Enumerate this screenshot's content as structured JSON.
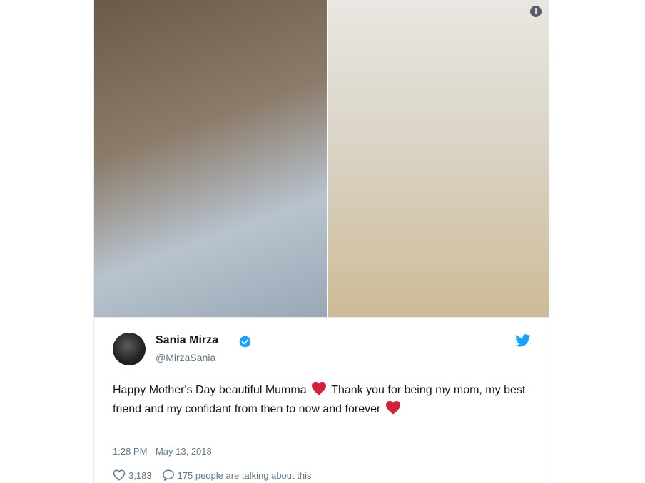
{
  "tweet": {
    "display_name": "Sania Mirza",
    "handle": "@MirzaSania",
    "text_part1": "Happy Mother's Day beautiful Mumma",
    "text_part2": "Thank you for being my mom, my best friend and my confidant from then to now and forever",
    "timestamp": "1:28 PM - May 13, 2018",
    "like_count": "3,183",
    "conversation_text": "175 people are talking about this"
  },
  "icons": {
    "info": "info-icon",
    "verified": "verified-badge-icon",
    "twitter": "twitter-bird-icon",
    "heart_emoji": "red-heart-emoji",
    "like": "heart-outline-icon",
    "reply": "speech-bubble-icon"
  },
  "colors": {
    "twitter_blue": "#1da1f2",
    "heart_red": "#d0223a",
    "text_primary": "#14171a",
    "text_secondary": "#657786"
  }
}
